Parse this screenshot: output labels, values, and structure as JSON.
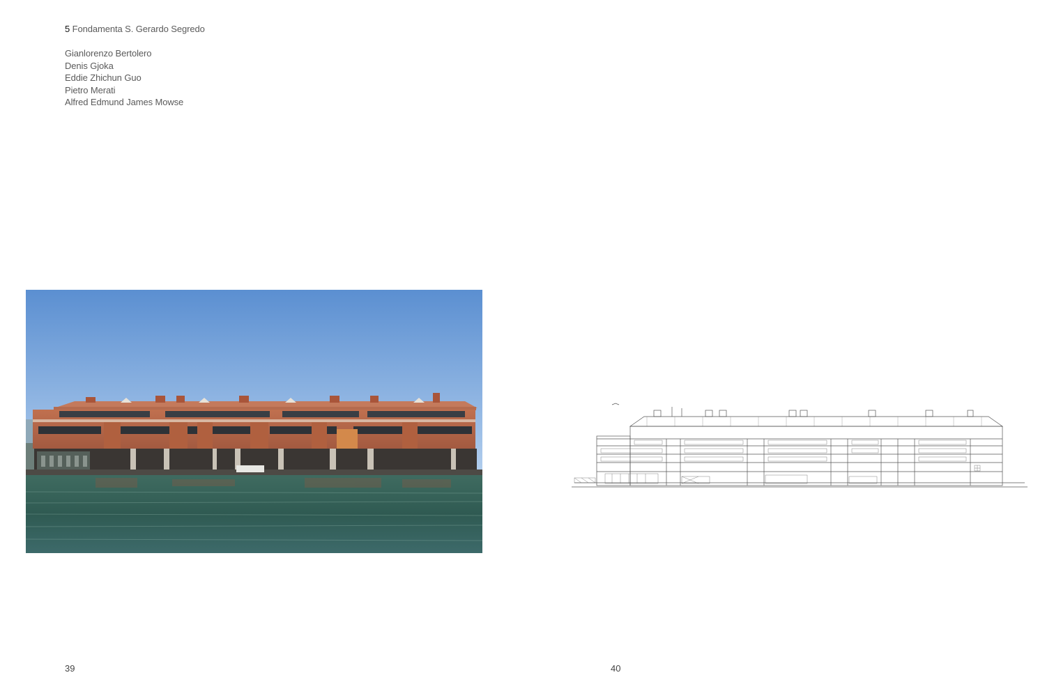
{
  "left_page": {
    "project": {
      "number": "5",
      "title": "Fondamenta S. Gerardo Segredo"
    },
    "authors": [
      "Gianlorenzo Bertolero",
      "Denis Gjoka",
      "Eddie Zhichun Guo",
      "Pietro Merati",
      "Alfred Edmund James Mowse"
    ],
    "page_number": "39"
  },
  "right_page": {
    "page_number": "40"
  },
  "colors": {
    "text": "#5a5a5a",
    "number_accent": "#111111",
    "sky_top": "#5b8fd1",
    "sky_bottom": "#a9c8ea",
    "brick": "#b5664a",
    "roof": "#c47a5c",
    "water": "#2f5a52",
    "drawing_line": "#555555"
  }
}
